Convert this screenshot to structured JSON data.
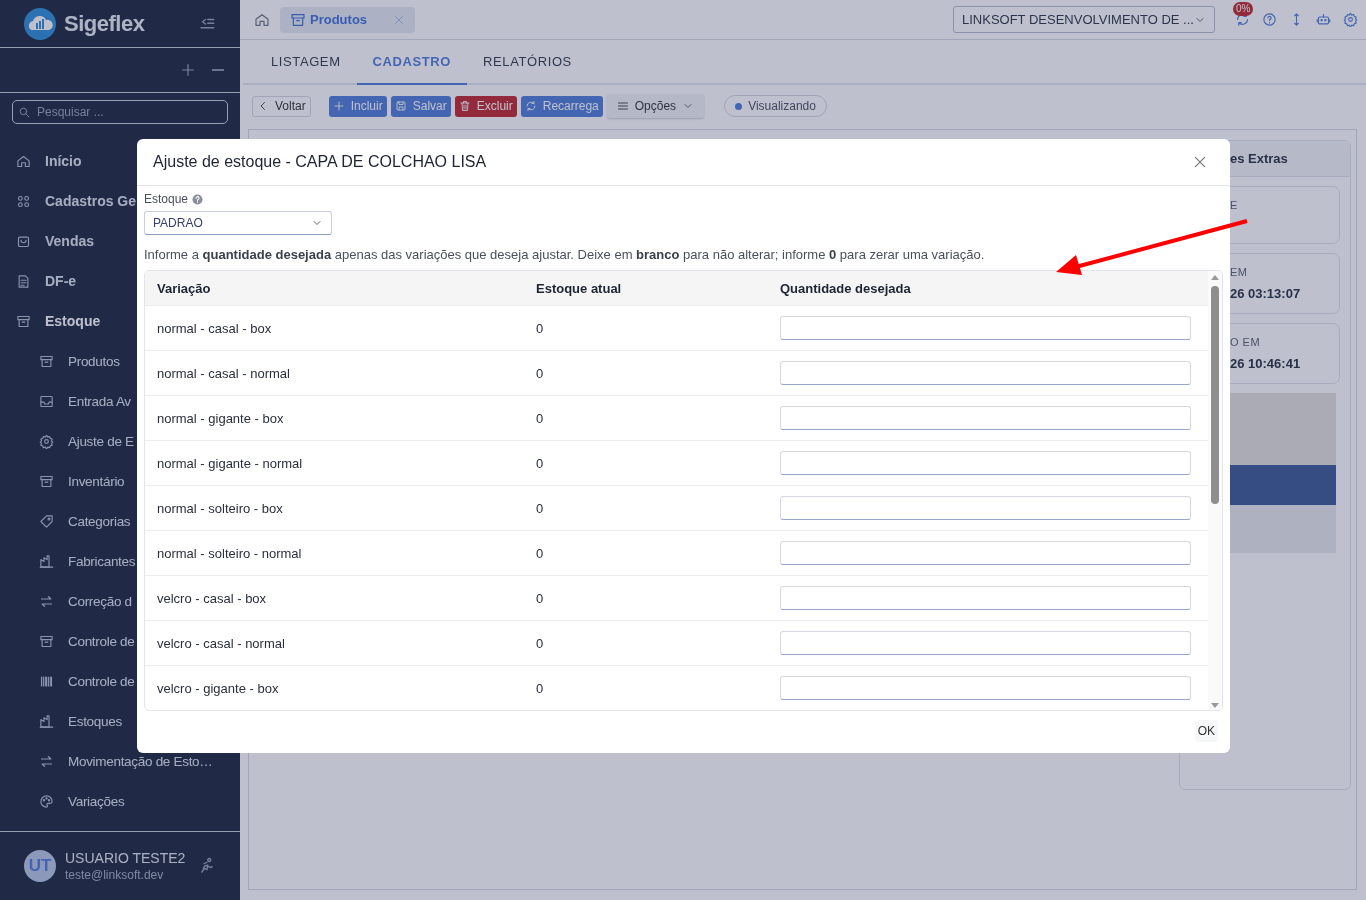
{
  "sidebar": {
    "brand": "Sigeflex",
    "search": {
      "placeholder": "Pesquisar ..."
    },
    "items": [
      {
        "label": "Início"
      },
      {
        "label": "Cadastros Ge"
      },
      {
        "label": "Vendas"
      },
      {
        "label": "DF-e"
      },
      {
        "label": "Estoque",
        "expanded": true,
        "children": [
          {
            "label": "Produtos"
          },
          {
            "label": "Entrada Av"
          },
          {
            "label": "Ajuste de E"
          },
          {
            "label": "Inventário"
          },
          {
            "label": "Categorias"
          },
          {
            "label": "Fabricantes"
          },
          {
            "label": "Correção d"
          },
          {
            "label": "Controle de"
          },
          {
            "label": "Controle de"
          },
          {
            "label": "Estoques"
          },
          {
            "label": "Movimentação de Esto…"
          },
          {
            "label": "Variações"
          }
        ]
      }
    ],
    "user": {
      "initials": "UT",
      "name": "USUARIO TESTE2",
      "email": "teste@linksoft.dev"
    }
  },
  "topbar": {
    "open_tab": "Produtos",
    "company": "LINKSOFT DESENVOLVIMENTO DE ...",
    "badge": "0%"
  },
  "tabs": [
    {
      "label": "LISTAGEM",
      "selected": false
    },
    {
      "label": "CADASTRO",
      "selected": true
    },
    {
      "label": "RELATÓRIOS",
      "selected": false
    }
  ],
  "toolbar": [
    {
      "label": "Voltar",
      "kind": "back"
    },
    {
      "label": "Incluir",
      "kind": "add"
    },
    {
      "label": "Salvar",
      "kind": "save"
    },
    {
      "label": "Excluir",
      "kind": "delete"
    },
    {
      "label": "Recarrega",
      "kind": "reload"
    },
    {
      "label": "Opções",
      "kind": "menu"
    }
  ],
  "mode": "Visualizando",
  "side_panel": {
    "title": "es Extras",
    "cards": [
      {
        "label": "E"
      },
      {
        "label": "EM",
        "value": "26 03:13:07"
      },
      {
        "label": "O EM",
        "value": "26 10:46:41"
      }
    ]
  },
  "dialog": {
    "title": "Ajuste de estoque - CAPA DE COLCHAO LISA",
    "stock_label": "Estoque",
    "stock_value": "PADRAO",
    "hint": "Informe a **quantidade desejada** apenas das variações que deseja ajustar. Deixe em **branco** para não alterar; informe **0** para zerar uma variação.",
    "columns": [
      "Variação",
      "Estoque atual",
      "Quantidade desejada"
    ],
    "rows": [
      {
        "variation": "normal - casal - box",
        "stock": "0"
      },
      {
        "variation": "normal - casal - normal",
        "stock": "0"
      },
      {
        "variation": "normal - gigante - box",
        "stock": "0"
      },
      {
        "variation": "normal - gigante - normal",
        "stock": "0"
      },
      {
        "variation": "normal - solteiro - box",
        "stock": "0"
      },
      {
        "variation": "normal - solteiro - normal",
        "stock": "0"
      },
      {
        "variation": "velcro - casal - box",
        "stock": "0"
      },
      {
        "variation": "velcro - casal - normal",
        "stock": "0"
      },
      {
        "variation": "velcro - gigante - box",
        "stock": "0"
      }
    ],
    "ok": "OK"
  }
}
